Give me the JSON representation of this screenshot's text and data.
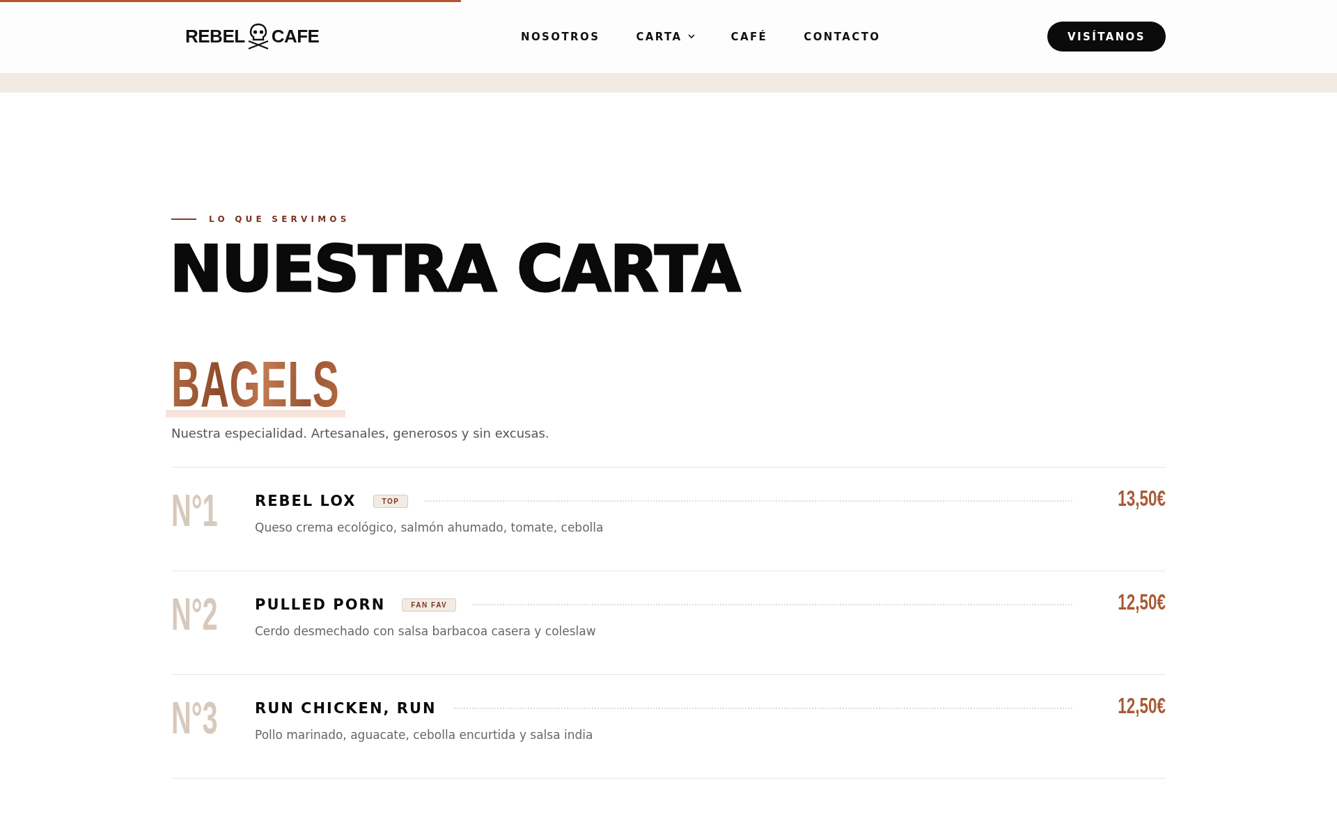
{
  "reading_progress": {
    "level": 0.345
  },
  "header": {
    "logo": {
      "left": "REBEL",
      "right": "CAFE"
    },
    "nav": [
      {
        "label": "NOSOTROS",
        "dropdown": false
      },
      {
        "label": "CARTA",
        "dropdown": true
      },
      {
        "label": "CAFÉ",
        "dropdown": false
      },
      {
        "label": "CONTACTO",
        "dropdown": false
      }
    ],
    "cta": "VISÍTANOS"
  },
  "section": {
    "eyebrow": "LO QUE SERVIMOS",
    "title": "NUESTRA CARTA"
  },
  "category": {
    "title": "BAGELS",
    "subtitle": "Nuestra especialidad. Artesanales, generosos y sin excusas.",
    "items": [
      {
        "number": "N°1",
        "name": "REBEL LOX",
        "badge": "TOP",
        "price": "13,50€",
        "description": "Queso crema ecológico, salmón ahumado, tomate, cebolla"
      },
      {
        "number": "N°2",
        "name": "PULLED PORN",
        "badge": "FAN FAV",
        "price": "12,50€",
        "description": "Cerdo desmechado con salsa barbacoa casera y coleslaw"
      },
      {
        "number": "N°3",
        "name": "RUN CHICKEN, RUN",
        "price": "12,50€",
        "description": "Pollo marinado, aguacate, cebolla encurtida y salsa india"
      }
    ]
  }
}
